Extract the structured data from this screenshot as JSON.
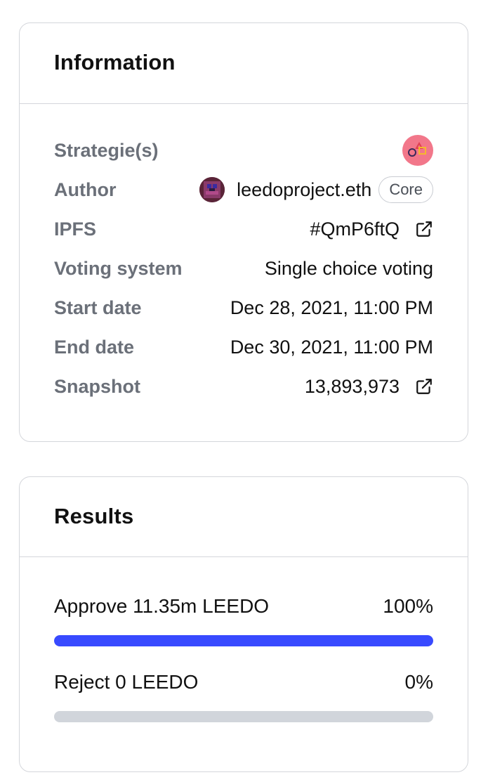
{
  "information": {
    "title": "Information",
    "strategies_label": "Strategie(s)",
    "strategy_icon": "strategy-shapes-icon",
    "author_label": "Author",
    "author_name": "leedoproject.eth",
    "author_badge": "Core",
    "ipfs_label": "IPFS",
    "ipfs_value": "#QmP6ftQ",
    "voting_system_label": "Voting system",
    "voting_system_value": "Single choice voting",
    "start_date_label": "Start date",
    "start_date_value": "Dec 28, 2021, 11:00 PM",
    "end_date_label": "End date",
    "end_date_value": "Dec 30, 2021, 11:00 PM",
    "snapshot_label": "Snapshot",
    "snapshot_value": "13,893,973"
  },
  "results": {
    "title": "Results",
    "choices": [
      {
        "label": "Approve 11.35m LEEDO",
        "percent_text": "100%",
        "fraction": 1.0
      },
      {
        "label": "Reject 0 LEEDO",
        "percent_text": "0%",
        "fraction": 0.0
      }
    ]
  },
  "colors": {
    "accent": "#384aff",
    "track": "#d1d5db",
    "label": "#6b7079",
    "border": "#d4d6db",
    "strategy_icon_bg": "#f2778a"
  }
}
